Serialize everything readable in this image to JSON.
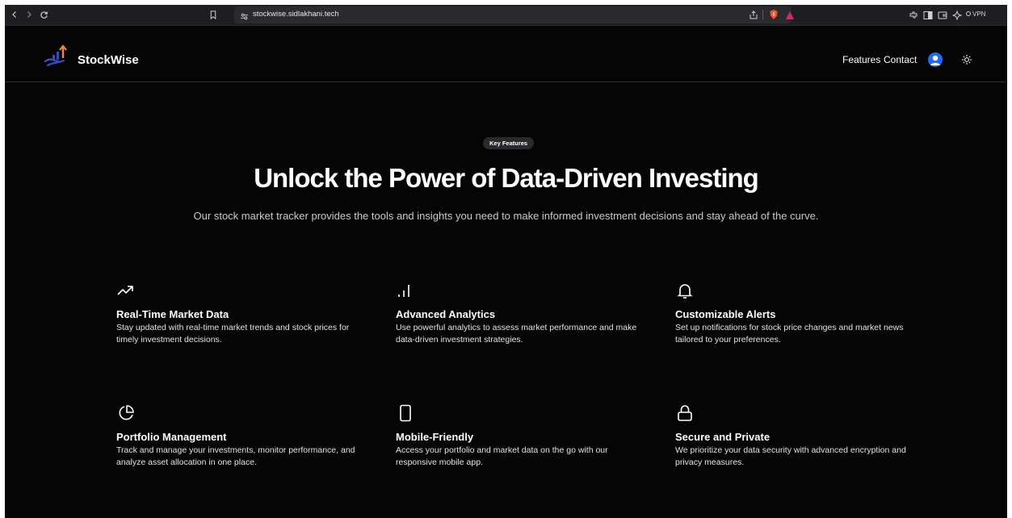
{
  "browser": {
    "url": "stockwise.sidlakhani.tech",
    "vpn_label": "VPN"
  },
  "header": {
    "brand": "StockWise",
    "nav": [
      "Features",
      "Contact"
    ]
  },
  "hero": {
    "badge": "Key Features",
    "title": "Unlock the Power of Data-Driven Investing",
    "subtitle": "Our stock market tracker provides the tools and insights you need to make informed investment decisions and stay ahead of the curve."
  },
  "features": [
    {
      "icon": "trending-up-icon",
      "title": "Real-Time Market Data",
      "desc": "Stay updated with real-time market trends and stock prices for timely investment decisions."
    },
    {
      "icon": "bar-chart-icon",
      "title": "Advanced Analytics",
      "desc": "Use powerful analytics to assess market performance and make data-driven investment strategies."
    },
    {
      "icon": "bell-icon",
      "title": "Customizable Alerts",
      "desc": "Set up notifications for stock price changes and market news tailored to your preferences."
    },
    {
      "icon": "pie-chart-icon",
      "title": "Portfolio Management",
      "desc": "Track and manage your investments, monitor performance, and analyze asset allocation in one place."
    },
    {
      "icon": "smartphone-icon",
      "title": "Mobile-Friendly",
      "desc": "Access your portfolio and market data on the go with our responsive mobile app."
    },
    {
      "icon": "lock-icon",
      "title": "Secure and Private",
      "desc": "We prioritize your data security with advanced encryption and privacy measures."
    }
  ],
  "colors": {
    "background": "#050505",
    "accent": "#1f6bff",
    "badge_bg": "#2a2a2e"
  }
}
